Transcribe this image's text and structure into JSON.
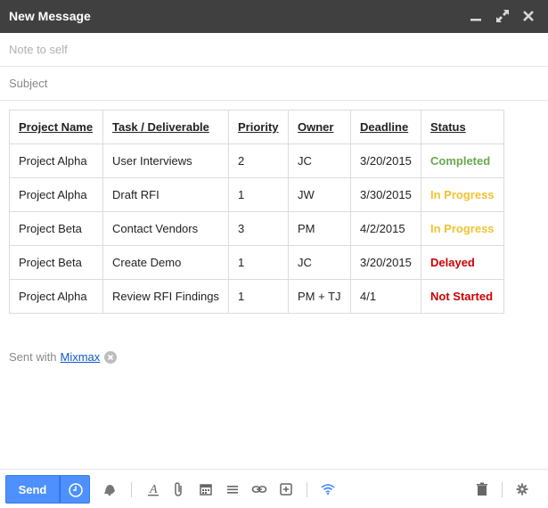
{
  "window": {
    "title": "New Message"
  },
  "compose": {
    "to_placeholder": "Note to self",
    "subject_placeholder": "Subject"
  },
  "table": {
    "headers": [
      "Project Name",
      "Task / Deliverable",
      "Priority",
      "Owner",
      "Deadline",
      "Status"
    ],
    "rows": [
      {
        "project": "Project Alpha",
        "task": "User Interviews",
        "priority": "2",
        "owner": "JC",
        "deadline": "3/20/2015",
        "status": "Completed",
        "status_color": "#6aa84f"
      },
      {
        "project": "Project Alpha",
        "task": "Draft RFI",
        "priority": "1",
        "owner": "JW",
        "deadline": "3/30/2015",
        "status": "In Progress",
        "status_color": "#f1c232"
      },
      {
        "project": "Project Beta",
        "task": "Contact Vendors",
        "priority": "3",
        "owner": "PM",
        "deadline": "4/2/2015",
        "status": "In Progress",
        "status_color": "#f1c232"
      },
      {
        "project": "Project Beta",
        "task": "Create Demo",
        "priority": "1",
        "owner": "JC",
        "deadline": "3/20/2015",
        "status": "Delayed",
        "status_color": "#cc0000"
      },
      {
        "project": "Project Alpha",
        "task": "Review RFI Findings",
        "priority": "1",
        "owner": "PM + TJ",
        "deadline": "4/1",
        "status": "Not Started",
        "status_color": "#cc0000"
      }
    ]
  },
  "signature": {
    "prefix": "Sent with",
    "link": "Mixmax"
  },
  "toolbar": {
    "send_label": "Send",
    "accent": "#4d90fe",
    "icons": [
      "clock-icon",
      "bell-icon",
      "text-format-icon",
      "attach-icon",
      "calendar-icon",
      "align-icon",
      "link-icon",
      "insert-icon",
      "wifi-icon",
      "trash-icon",
      "gear-icon"
    ]
  }
}
